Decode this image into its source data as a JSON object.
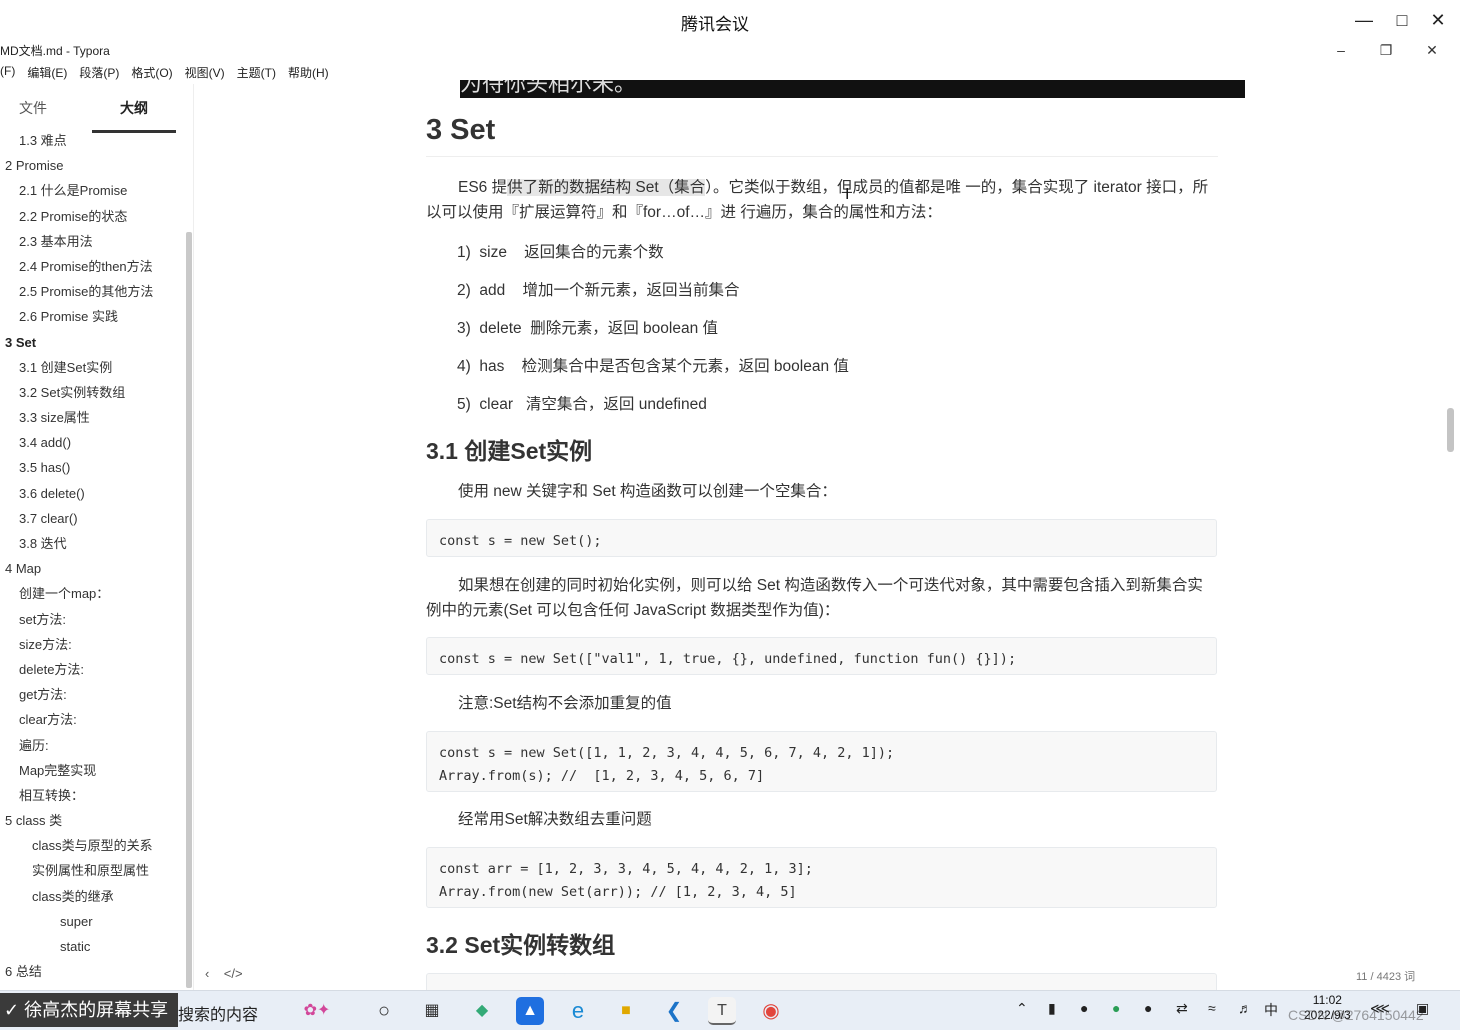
{
  "meeting": {
    "title": "腾讯会议"
  },
  "typora": {
    "title": "MD文档.md - Typora",
    "menu": [
      "文件(F)",
      "编辑(E)",
      "段落(P)",
      "格式(O)",
      "视图(V)",
      "主题(T)",
      "帮助(H)"
    ],
    "menu_visible": [
      "(F)",
      "编辑(E)",
      "段落(P)",
      "格式(O)",
      "视图(V)",
      "主题(T)",
      "帮助(H)"
    ]
  },
  "sidebar": {
    "tabs": [
      "文件",
      "大纲"
    ],
    "active_tab": "大纲",
    "outline": [
      {
        "label": "1.3 难点",
        "level": 2
      },
      {
        "label": "2 Promise",
        "level": 1
      },
      {
        "label": "2.1 什么是Promise",
        "level": 2
      },
      {
        "label": "2.2 Promise的状态",
        "level": 2
      },
      {
        "label": "2.3 基本用法",
        "level": 2
      },
      {
        "label": "2.4 Promise的then方法",
        "level": 2
      },
      {
        "label": "2.5 Promise的其他方法",
        "level": 2
      },
      {
        "label": "2.6 Promise 实践",
        "level": 2
      },
      {
        "label": "3 Set",
        "level": 1,
        "active": true
      },
      {
        "label": "3.1 创建Set实例",
        "level": 2
      },
      {
        "label": "3.2 Set实例转数组",
        "level": 2
      },
      {
        "label": "3.3 size属性",
        "level": 2
      },
      {
        "label": "3.4 add()",
        "level": 2
      },
      {
        "label": "3.5 has()",
        "level": 2
      },
      {
        "label": "3.6 delete()",
        "level": 2
      },
      {
        "label": "3.7 clear()",
        "level": 2
      },
      {
        "label": "3.8 迭代",
        "level": 2
      },
      {
        "label": "4 Map",
        "level": 1
      },
      {
        "label": "创建一个map：",
        "level": 2
      },
      {
        "label": "set方法:",
        "level": 2
      },
      {
        "label": "size方法:",
        "level": 2
      },
      {
        "label": "delete方法:",
        "level": 2
      },
      {
        "label": "get方法:",
        "level": 2
      },
      {
        "label": "clear方法:",
        "level": 2
      },
      {
        "label": "遍历:",
        "level": 2
      },
      {
        "label": "Map完整实现",
        "level": 2
      },
      {
        "label": "相互转换：",
        "level": 2
      },
      {
        "label": "5 class 类",
        "level": 1
      },
      {
        "label": "class类与原型的关系",
        "level": 3
      },
      {
        "label": "实例属性和原型属性",
        "level": 3
      },
      {
        "label": "class类的继承",
        "level": 3
      },
      {
        "label": "super",
        "level": 4
      },
      {
        "label": "static",
        "level": 4
      },
      {
        "label": "6 总结",
        "level": 1
      }
    ]
  },
  "doc": {
    "image_caption": "为待你头相尔未。",
    "h1": "3 Set",
    "intro_pre": "ES6 提",
    "intro_hl": "供了新的数据结构 Set（集合",
    "intro_post": "）。它类似于数组，但成员的值都是唯 一的，集合实现了 iterator 接口，所以可以使用『扩展运算符』和『for…of…』进 行遍历，集合的属性和方法：",
    "list": [
      "1)  size    返回集合的元素个数",
      "2)  add    增加一个新元素，返回当前集合",
      "3)  delete  删除元素，返回 boolean 值",
      "4)  has    检测集合中是否包含某个元素，返回 boolean 值",
      "5)  clear   清空集合，返回 undefined"
    ],
    "h2_1": "3.1 创建Set实例",
    "p_create": "使用 new 关键字和 Set 构造函数可以创建一个空集合：",
    "code1": "const s = new Set();",
    "p_init": "如果想在创建的同时初始化实例，则可以给 Set 构造函数传入一个可迭代对象，其中需要包含插入到新集合实例中的元素(Set 可以包含任何 JavaScript 数据类型作为值)：",
    "code2": "const s = new Set([\"val1\", 1, true, {}, undefined, function fun() {}]);",
    "p_note": "注意:Set结构不会添加重复的值",
    "code3": "const s = new Set([1, 1, 2, 3, 4, 4, 5, 6, 7, 4, 2, 1]);\nArray.from(s); //  [1, 2, 3, 4, 5, 6, 7]",
    "p_dedupe": "经常用Set解决数组去重问题",
    "code4": "const arr = [1, 2, 3, 3, 4, 5, 4, 4, 2, 1, 3];\nArray.from(new Set(arr)); // [1, 2, 3, 4, 5]",
    "h2_2": "3.2 Set实例转数组"
  },
  "status": {
    "word_count": "11 / 4423 词"
  },
  "taskbar": {
    "share": "徐高杰的屏幕共享",
    "search": "搜索的内容",
    "time": "11:02",
    "date": "2022/9/3",
    "ime": "中",
    "watermark": "CSDN @2764150442"
  }
}
